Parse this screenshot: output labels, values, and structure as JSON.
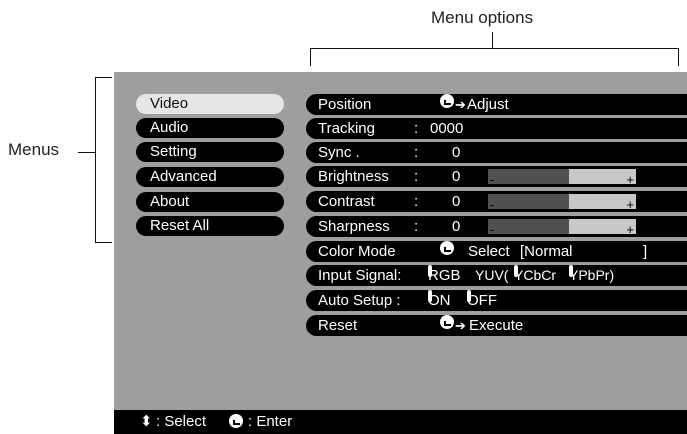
{
  "callouts": {
    "menu_options": "Menu options",
    "menus": "Menus"
  },
  "menus": [
    "Video",
    "Audio",
    "Setting",
    "Advanced",
    "About",
    "Reset All"
  ],
  "options": {
    "position": {
      "label": "Position",
      "action": "Adjust"
    },
    "tracking": {
      "label": "Tracking",
      "sep": ":",
      "value": "0000"
    },
    "sync": {
      "label": "Sync .",
      "sep": ":",
      "value": "0"
    },
    "brightness": {
      "label": "Brightness",
      "sep": ":",
      "value": "0",
      "minus": "-",
      "plus": "+",
      "level": 0.55
    },
    "contrast": {
      "label": "Contrast",
      "sep": ":",
      "value": "0",
      "minus": "-",
      "plus": "+",
      "level": 0.55
    },
    "sharpness": {
      "label": "Sharpness",
      "sep": ":",
      "value": "0",
      "minus": "-",
      "plus": "+",
      "level": 0.55
    },
    "color_mode": {
      "label": "Color Mode",
      "action": "Select",
      "value": "[Normal",
      "close": "]"
    },
    "input_signal": {
      "label": "Input Signal:",
      "opt1": "RGB",
      "opt2": "YUV(",
      "opt3": "YCbCr",
      "opt4": "YPbPr)"
    },
    "auto_setup": {
      "label": "Auto Setup :",
      "on": "ON",
      "off": "OFF"
    },
    "reset": {
      "label": "Reset",
      "action": "Execute"
    }
  },
  "status": {
    "select_glyph": "⬍",
    "select": ": Select",
    "enter": ": Enter"
  }
}
